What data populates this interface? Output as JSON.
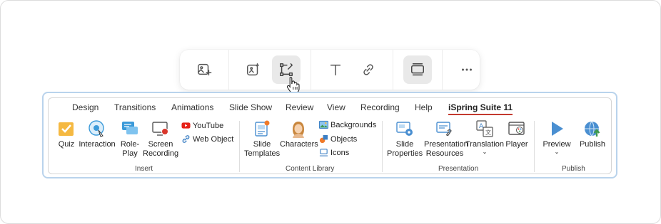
{
  "ribbon": {
    "tabs": [
      "Design",
      "Transitions",
      "Animations",
      "Slide Show",
      "Review",
      "View",
      "Recording",
      "Help",
      "iSpring Suite 11"
    ],
    "active_tab": "iSpring Suite 11",
    "groups": {
      "insert": {
        "label": "Insert",
        "quiz": "Quiz",
        "interaction": "Interaction",
        "roleplay_1": "Role-",
        "roleplay_2": "Play",
        "screen_1": "Screen",
        "screen_2": "Recording",
        "youtube": "YouTube",
        "web_object": "Web Object"
      },
      "content_library": {
        "label": "Content Library",
        "templates_1": "Slide",
        "templates_2": "Templates",
        "characters": "Characters",
        "backgrounds": "Backgrounds",
        "objects": "Objects",
        "icons": "Icons"
      },
      "presentation": {
        "label": "Presentation",
        "slide_props_1": "Slide",
        "slide_props_2": "Properties",
        "pres_res_1": "Presentation",
        "pres_res_2": "Resources",
        "translation": "Translation",
        "player": "Player"
      },
      "publish": {
        "label": "Publish",
        "preview": "Preview",
        "publish": "Publish"
      }
    }
  },
  "floating_toolbar": {
    "icons": [
      "add-image-icon",
      "image-ai-icon",
      "shape-edit-icon",
      "text-icon",
      "link-icon",
      "layout-icon",
      "more-icon"
    ],
    "active": "shape-edit-icon"
  },
  "colors": {
    "active_tab_underline": "#c33a2f",
    "ribbon_border": "#b9d3ec"
  }
}
